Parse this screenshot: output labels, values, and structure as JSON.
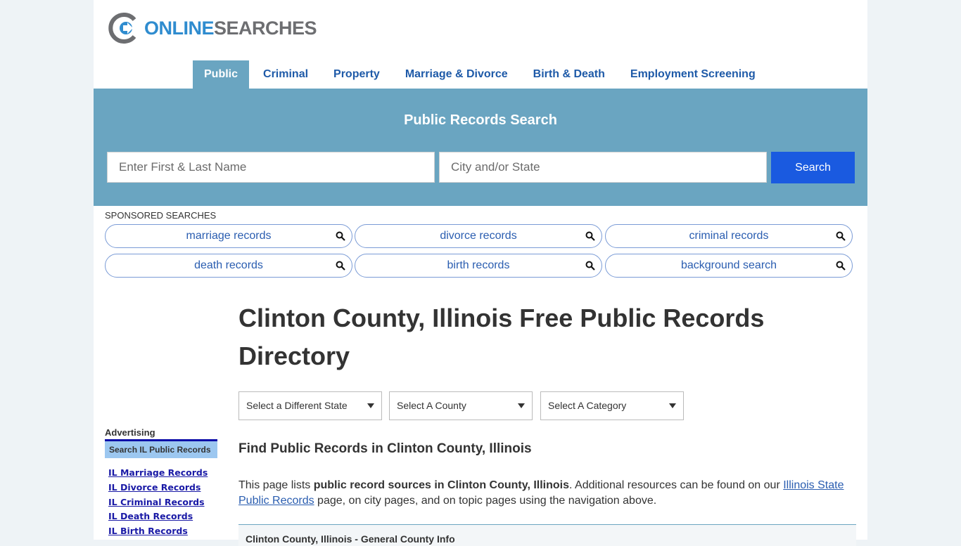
{
  "logo": {
    "part1": "ONLINE",
    "part2": "SEARCHES"
  },
  "nav": {
    "items": [
      {
        "label": "Public",
        "active": true
      },
      {
        "label": "Criminal",
        "active": false
      },
      {
        "label": "Property",
        "active": false
      },
      {
        "label": "Marriage & Divorce",
        "active": false
      },
      {
        "label": "Birth & Death",
        "active": false
      },
      {
        "label": "Employment Screening",
        "active": false
      }
    ]
  },
  "hero": {
    "title": "Public Records Search",
    "name_placeholder": "Enter First & Last Name",
    "city_placeholder": "City and/or State",
    "search_label": "Search"
  },
  "sponsored": {
    "label": "SPONSORED SEARCHES",
    "items": [
      "marriage records",
      "divorce records",
      "criminal records",
      "death records",
      "birth records",
      "background search"
    ]
  },
  "main": {
    "title": "Clinton County, Illinois Free Public Records Directory",
    "selects": [
      "Select a Different State",
      "Select A County",
      "Select A Category"
    ],
    "subtitle": "Find Public Records in Clinton County, Illinois",
    "para": {
      "t1": "This page lists ",
      "bold": "public record sources in Clinton County, Illinois",
      "t2": ". Additional resources can be found on our ",
      "link": "Illinois State Public Records",
      "t3": " page, on city pages, and on topic pages using the navigation above."
    },
    "info_box_title": "Clinton County, Illinois - General County Info"
  },
  "sidebar": {
    "advertising": "Advertising",
    "box_title": "Search IL Public Records",
    "links": [
      "IL Marriage Records",
      "IL Divorce Records",
      "IL Criminal Records",
      "IL Death Records",
      "IL Birth Records"
    ]
  }
}
